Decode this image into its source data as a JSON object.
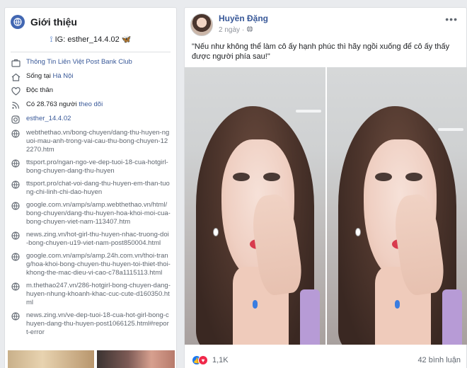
{
  "intro": {
    "title": "Giới thiệu",
    "ig_handle": "IG: esther_14.4.02",
    "workplace": "Thông Tin Liên Việt Post Bank Club",
    "lives_prefix": "Sống tại ",
    "lives_city": "Hà Nội",
    "relationship": "Độc thân",
    "followers_prefix": "Có 28.763 người ",
    "followers_suffix": "theo dõi",
    "instagram": "esther_14.4.02",
    "links": [
      "webthethao.vn/bong-chuyen/dang-thu-huyen-nguoi-mau-anh-trong-vai-cau-thu-bong-chuyen-122270.htm",
      "ttsport.pro/ngan-ngo-ve-dep-tuoi-18-cua-hotgirl-bong-chuyen-dang-thu-huyen",
      "ttsport.pro/chat-voi-dang-thu-huyen-em-than-tuong-chi-linh-chi-dao-huyen",
      "google.com.vn/amp/s/amp.webthethao.vn/html/bong-chuyen/dang-thu-huyen-hoa-khoi-moi-cua-bong-chuyen-viet-nam-113407.htm",
      "news.zing.vn/hot-girl-thu-huyen-nhac-truong-doi-bong-chuyen-u19-viet-nam-post850004.html",
      "google.com.vn/amp/s/amp.24h.com.vn/thoi-trang/hoa-khoi-bong-chuyen-thu-huyen-toi-thiet-thoi-khong-the-mac-dieu-vi-cao-c78a1115113.html",
      "m.thethao247.vn/286-hotgirl-bong-chuyen-dang-huyen-nhung-khoanh-khac-cuc-cute-d160350.html",
      "news.zing.vn/ve-dep-tuoi-18-cua-hot-girl-bong-chuyen-dang-thu-huyen-post1066125.html#report-error"
    ]
  },
  "post": {
    "author": "Huyền Đặng",
    "time": "2 ngày",
    "privacy_icon": "globe-icon",
    "more": "•••",
    "caption": "\"Nếu như không thể làm cô ấy hạnh phúc thì hãy ngồi xuống để cô ấy thấy được người phía sau!\"",
    "reactions_count": "1,1K",
    "comments": "42 bình luận"
  },
  "colors": {
    "link_blue": "#385898",
    "like_blue": "#1877f2",
    "love_red": "#f0284a",
    "page_bg": "#e9ebee"
  }
}
